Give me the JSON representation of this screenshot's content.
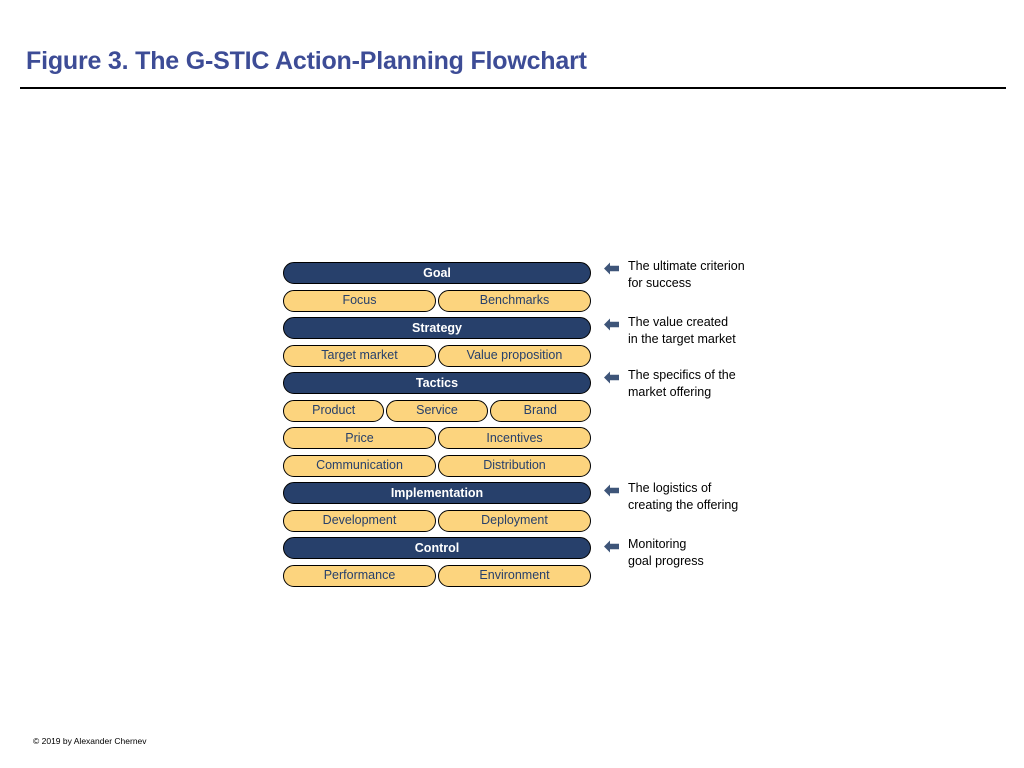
{
  "slide": {
    "title": "Figure 3. The G-STIC Action-Planning Flowchart",
    "footer": "© 2019 by Alexander Chernev",
    "colors": {
      "title": "#3D4C96",
      "header_bar": "#27406B",
      "item_box": "#FCD47E",
      "item_text": "#27406B",
      "header_text": "#FFFFFF",
      "outline": "#000000",
      "arrow": "#3E5579",
      "annotation_text": "#000000"
    }
  },
  "flowchart": {
    "sections": [
      {
        "header": "Goal",
        "items": [
          "Focus",
          "Benchmarks"
        ]
      },
      {
        "header": "Strategy",
        "items": [
          "Target market",
          "Value proposition"
        ]
      },
      {
        "header": "Tactics",
        "items_row1": [
          "Product",
          "Service",
          "Brand"
        ],
        "items_row2": [
          "Price",
          "Incentives"
        ],
        "items_row3": [
          "Communication",
          "Distribution"
        ]
      },
      {
        "header": "Implementation",
        "items": [
          "Development",
          "Deployment"
        ]
      },
      {
        "header": "Control",
        "items": [
          "Performance",
          "Environment"
        ]
      }
    ]
  },
  "annotations": [
    {
      "icon": "left-arrow-icon",
      "text": "The ultimate criterion\nfor success",
      "target": "Goal"
    },
    {
      "icon": "left-arrow-icon",
      "text": "The value created\nin the target market",
      "target": "Strategy"
    },
    {
      "icon": "left-arrow-icon",
      "text": "The specifics of the\nmarket offering",
      "target": "Tactics"
    },
    {
      "icon": "left-arrow-icon",
      "text": "The logistics of\ncreating the offering",
      "target": "Implementation"
    },
    {
      "icon": "left-arrow-icon",
      "text": "Monitoring\ngoal progress",
      "target": "Control"
    }
  ]
}
